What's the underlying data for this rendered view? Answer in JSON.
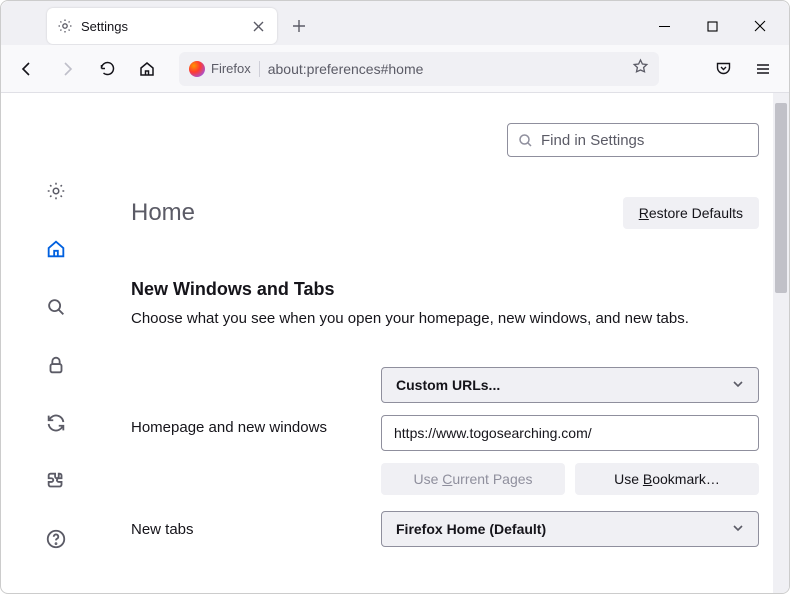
{
  "tab": {
    "title": "Settings"
  },
  "toolbar": {
    "identity": "Firefox",
    "url": "about:preferences#home"
  },
  "search": {
    "placeholder": "Find in Settings"
  },
  "page": {
    "title": "Home",
    "restore_btn": "Restore Defaults"
  },
  "section": {
    "heading": "New Windows and Tabs",
    "description": "Choose what you see when you open your homepage, new windows, and new tabs."
  },
  "homepage": {
    "label": "Homepage and new windows",
    "dropdown": "Custom URLs...",
    "url_value": "https://www.togosearching.com/",
    "use_current": "Use Current Pages",
    "use_bookmark": "Use Bookmark…"
  },
  "newtabs": {
    "label": "New tabs",
    "dropdown": "Firefox Home (Default)"
  }
}
